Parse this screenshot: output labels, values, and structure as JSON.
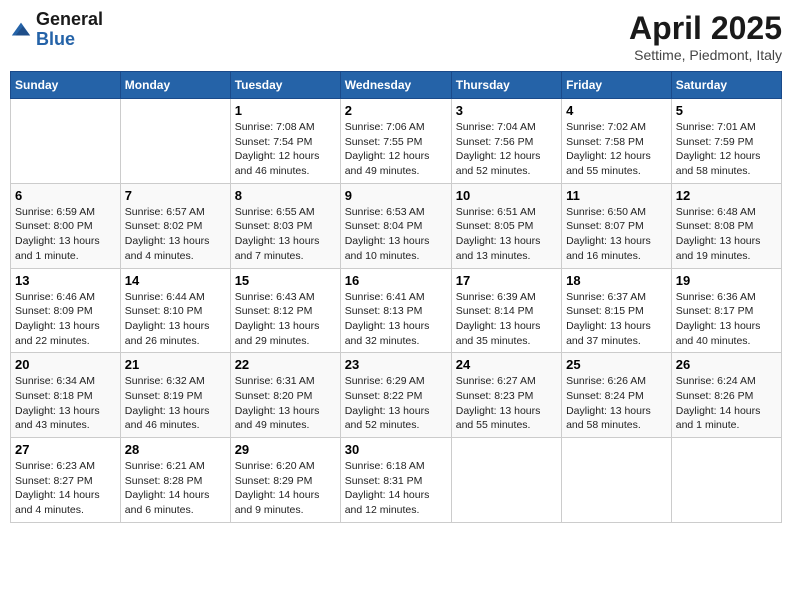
{
  "header": {
    "logo_general": "General",
    "logo_blue": "Blue",
    "title": "April 2025",
    "subtitle": "Settime, Piedmont, Italy"
  },
  "days_of_week": [
    "Sunday",
    "Monday",
    "Tuesday",
    "Wednesday",
    "Thursday",
    "Friday",
    "Saturday"
  ],
  "weeks": [
    [
      {
        "day": "",
        "info": ""
      },
      {
        "day": "",
        "info": ""
      },
      {
        "day": "1",
        "info": "Sunrise: 7:08 AM\nSunset: 7:54 PM\nDaylight: 12 hours and 46 minutes."
      },
      {
        "day": "2",
        "info": "Sunrise: 7:06 AM\nSunset: 7:55 PM\nDaylight: 12 hours and 49 minutes."
      },
      {
        "day": "3",
        "info": "Sunrise: 7:04 AM\nSunset: 7:56 PM\nDaylight: 12 hours and 52 minutes."
      },
      {
        "day": "4",
        "info": "Sunrise: 7:02 AM\nSunset: 7:58 PM\nDaylight: 12 hours and 55 minutes."
      },
      {
        "day": "5",
        "info": "Sunrise: 7:01 AM\nSunset: 7:59 PM\nDaylight: 12 hours and 58 minutes."
      }
    ],
    [
      {
        "day": "6",
        "info": "Sunrise: 6:59 AM\nSunset: 8:00 PM\nDaylight: 13 hours and 1 minute."
      },
      {
        "day": "7",
        "info": "Sunrise: 6:57 AM\nSunset: 8:02 PM\nDaylight: 13 hours and 4 minutes."
      },
      {
        "day": "8",
        "info": "Sunrise: 6:55 AM\nSunset: 8:03 PM\nDaylight: 13 hours and 7 minutes."
      },
      {
        "day": "9",
        "info": "Sunrise: 6:53 AM\nSunset: 8:04 PM\nDaylight: 13 hours and 10 minutes."
      },
      {
        "day": "10",
        "info": "Sunrise: 6:51 AM\nSunset: 8:05 PM\nDaylight: 13 hours and 13 minutes."
      },
      {
        "day": "11",
        "info": "Sunrise: 6:50 AM\nSunset: 8:07 PM\nDaylight: 13 hours and 16 minutes."
      },
      {
        "day": "12",
        "info": "Sunrise: 6:48 AM\nSunset: 8:08 PM\nDaylight: 13 hours and 19 minutes."
      }
    ],
    [
      {
        "day": "13",
        "info": "Sunrise: 6:46 AM\nSunset: 8:09 PM\nDaylight: 13 hours and 22 minutes."
      },
      {
        "day": "14",
        "info": "Sunrise: 6:44 AM\nSunset: 8:10 PM\nDaylight: 13 hours and 26 minutes."
      },
      {
        "day": "15",
        "info": "Sunrise: 6:43 AM\nSunset: 8:12 PM\nDaylight: 13 hours and 29 minutes."
      },
      {
        "day": "16",
        "info": "Sunrise: 6:41 AM\nSunset: 8:13 PM\nDaylight: 13 hours and 32 minutes."
      },
      {
        "day": "17",
        "info": "Sunrise: 6:39 AM\nSunset: 8:14 PM\nDaylight: 13 hours and 35 minutes."
      },
      {
        "day": "18",
        "info": "Sunrise: 6:37 AM\nSunset: 8:15 PM\nDaylight: 13 hours and 37 minutes."
      },
      {
        "day": "19",
        "info": "Sunrise: 6:36 AM\nSunset: 8:17 PM\nDaylight: 13 hours and 40 minutes."
      }
    ],
    [
      {
        "day": "20",
        "info": "Sunrise: 6:34 AM\nSunset: 8:18 PM\nDaylight: 13 hours and 43 minutes."
      },
      {
        "day": "21",
        "info": "Sunrise: 6:32 AM\nSunset: 8:19 PM\nDaylight: 13 hours and 46 minutes."
      },
      {
        "day": "22",
        "info": "Sunrise: 6:31 AM\nSunset: 8:20 PM\nDaylight: 13 hours and 49 minutes."
      },
      {
        "day": "23",
        "info": "Sunrise: 6:29 AM\nSunset: 8:22 PM\nDaylight: 13 hours and 52 minutes."
      },
      {
        "day": "24",
        "info": "Sunrise: 6:27 AM\nSunset: 8:23 PM\nDaylight: 13 hours and 55 minutes."
      },
      {
        "day": "25",
        "info": "Sunrise: 6:26 AM\nSunset: 8:24 PM\nDaylight: 13 hours and 58 minutes."
      },
      {
        "day": "26",
        "info": "Sunrise: 6:24 AM\nSunset: 8:26 PM\nDaylight: 14 hours and 1 minute."
      }
    ],
    [
      {
        "day": "27",
        "info": "Sunrise: 6:23 AM\nSunset: 8:27 PM\nDaylight: 14 hours and 4 minutes."
      },
      {
        "day": "28",
        "info": "Sunrise: 6:21 AM\nSunset: 8:28 PM\nDaylight: 14 hours and 6 minutes."
      },
      {
        "day": "29",
        "info": "Sunrise: 6:20 AM\nSunset: 8:29 PM\nDaylight: 14 hours and 9 minutes."
      },
      {
        "day": "30",
        "info": "Sunrise: 6:18 AM\nSunset: 8:31 PM\nDaylight: 14 hours and 12 minutes."
      },
      {
        "day": "",
        "info": ""
      },
      {
        "day": "",
        "info": ""
      },
      {
        "day": "",
        "info": ""
      }
    ]
  ]
}
